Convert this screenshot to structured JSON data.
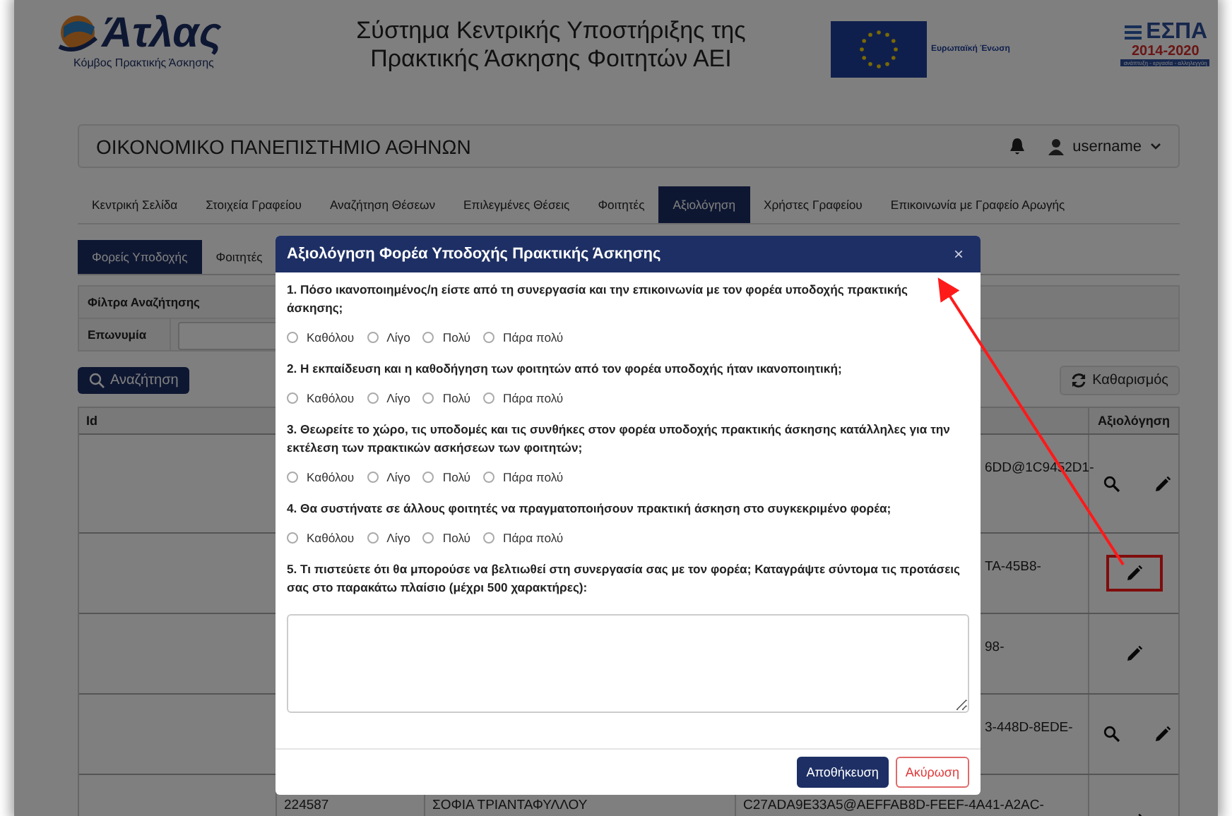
{
  "header": {
    "logo_name": "Άτλας",
    "logo_tagline": "Κόμβος Πρακτικής Άσκησης",
    "title_lines": [
      "Σύστημα Κεντρικής Υποστήριξης της",
      "Πρακτικής Άσκησης Φοιτητών ΑΕΙ"
    ],
    "eu_label": "Ευρωπαϊκή Ένωση",
    "espa_name": "ΕΣΠΑ",
    "espa_years": "2014-2020",
    "espa_motto": "ανάπτυξη - εργασία - αλληλεγγύη"
  },
  "institution_bar": {
    "institution": "ΟΙΚΟΝΟΜΙΚΟ ΠΑΝΕΠΙΣΤΗΜΙΟ ΑΘΗΝΩΝ",
    "user": "username"
  },
  "nav_tabs": [
    {
      "label": "Κεντρική Σελίδα",
      "selected": false
    },
    {
      "label": "Στοιχεία Γραφείου",
      "selected": false
    },
    {
      "label": "Αναζήτηση Θέσεων",
      "selected": false
    },
    {
      "label": "Επιλεγμένες Θέσεις",
      "selected": false
    },
    {
      "label": "Φοιτητές",
      "selected": false
    },
    {
      "label": "Αξιολόγηση",
      "selected": true
    },
    {
      "label": "Χρήστες Γραφείου",
      "selected": false
    },
    {
      "label": "Επικοινωνία με Γραφείο Αρωγής",
      "selected": false
    }
  ],
  "sub_tabs": [
    {
      "label": "Φορείς Υποδοχής",
      "selected": true
    },
    {
      "label": "Φοιτητές",
      "selected": false
    }
  ],
  "filters": {
    "title": "Φίλτρα Αναζήτησης",
    "fields": [
      {
        "label": "Επωνυμία"
      }
    ]
  },
  "search_button": "Αναζήτηση",
  "clear_button": "Καθαρισμός",
  "table": {
    "columns": [
      "Id",
      "Αξιολόγηση"
    ],
    "rows": [
      {
        "column_4": "6DD@1C9452D1-",
        "actions": [
          {
            "kind": "view"
          },
          {
            "kind": "edit"
          }
        ],
        "highlighted": false
      },
      {
        "column_4": "TA-45B8-",
        "actions": [
          {
            "kind": "edit"
          }
        ],
        "highlighted": true
      },
      {
        "column_4": "98-",
        "actions": [
          {
            "kind": "edit"
          }
        ],
        "highlighted": false
      },
      {
        "column_4": "3-448D-8EDE-",
        "actions": [
          {
            "kind": "view"
          },
          {
            "kind": "edit"
          }
        ],
        "highlighted": false
      },
      {
        "column_2": "224587",
        "column_3": "ΣΟΦΙΑ ΤΡΙΑΝΤΑΦΥΛΛΟΥ",
        "column_4": "C27ADA9E33A5@AEFFAB8D-FEEF-4A41-A2AC-",
        "actions": [
          {
            "kind": "edit"
          }
        ],
        "highlighted": false
      }
    ]
  },
  "modal": {
    "title": "Αξιολόγηση Φορέα Υποδοχής Πρακτικής Άσκησης",
    "close": "×",
    "questions": [
      {
        "kind": "radio",
        "text": "1. Πόσο ικανοποιημένος/η είστε από τη συνεργασία και την επικοινωνία με τον φορέα υποδοχής πρακτικής άσκησης;",
        "options": [
          {
            "label": "Καθόλου",
            "selected": false
          },
          {
            "label": "Λίγο",
            "selected": false
          },
          {
            "label": "Πολύ",
            "selected": false
          },
          {
            "label": "Πάρα πολύ",
            "selected": false
          }
        ]
      },
      {
        "kind": "radio",
        "text": "2. Η εκπαίδευση και η καθοδήγηση των φοιτητών από τον φορέα υποδοχής ήταν ικανοποιητική;",
        "options": [
          {
            "label": "Καθόλου",
            "selected": false
          },
          {
            "label": "Λίγο",
            "selected": false
          },
          {
            "label": "Πολύ",
            "selected": false
          },
          {
            "label": "Πάρα πολύ",
            "selected": false
          }
        ]
      },
      {
        "kind": "radio",
        "text": "3. Θεωρείτε το χώρο, τις υποδομές και τις συνθήκες στον φορέα υποδοχής πρακτικής άσκησης κατάλληλες για την εκτέλεση των πρακτικών ασκήσεων των φοιτητών;",
        "options": [
          {
            "label": "Καθόλου",
            "selected": false
          },
          {
            "label": "Λίγο",
            "selected": false
          },
          {
            "label": "Πολύ",
            "selected": false
          },
          {
            "label": "Πάρα πολύ",
            "selected": false
          }
        ]
      },
      {
        "kind": "radio",
        "text": "4. Θα συστήνατε σε άλλους φοιτητές να πραγματοποιήσουν πρακτική άσκηση στο συγκεκριμένο φορέα;",
        "options": [
          {
            "label": "Καθόλου",
            "selected": false
          },
          {
            "label": "Λίγο",
            "selected": false
          },
          {
            "label": "Πολύ",
            "selected": false
          },
          {
            "label": "Πάρα πολύ",
            "selected": false
          }
        ]
      },
      {
        "kind": "text",
        "text": "5. Τι πιστεύετε ότι θα μπορούσε να βελτιωθεί στη συνεργασία σας με τον φορέα; Καταγράψτε σύντομα τις προτάσεις σας στο παρακάτω πλαίσιο (μέχρι 500 χαρακτήρες):"
      }
    ],
    "buttons": [
      {
        "kind": "primary",
        "label": "Αποθήκευση"
      },
      {
        "kind": "cancel",
        "label": "Ακύρωση"
      }
    ]
  }
}
